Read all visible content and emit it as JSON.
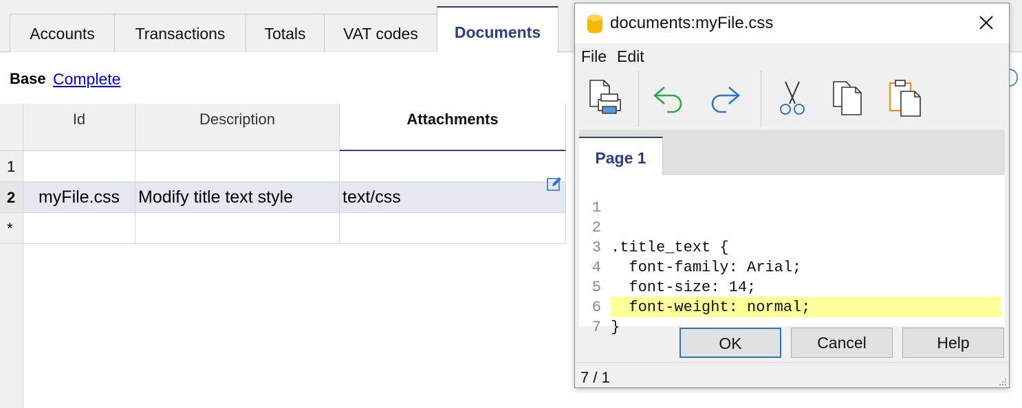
{
  "main": {
    "tabs": [
      {
        "label": "Accounts"
      },
      {
        "label": "Transactions"
      },
      {
        "label": "Totals"
      },
      {
        "label": "VAT codes"
      },
      {
        "label": "Documents"
      }
    ],
    "views": {
      "base": "Base",
      "complete": "Complete"
    },
    "table": {
      "columns": [
        "Id",
        "Description",
        "Attachments"
      ],
      "rows": [
        {
          "num": "1",
          "id": "",
          "description": "",
          "attachments": ""
        },
        {
          "num": "2",
          "id": "myFile.css",
          "description": "Modify title text style",
          "attachments": "text/css"
        },
        {
          "num": "*",
          "id": "",
          "description": "",
          "attachments": ""
        }
      ]
    }
  },
  "dialog": {
    "title": "documents:myFile.css",
    "menu": [
      "File",
      "Edit"
    ],
    "toolbar": [
      "print-icon",
      "undo-icon",
      "redo-icon",
      "cut-icon",
      "copy-icon",
      "paste-icon"
    ],
    "page_tab": "Page 1",
    "code_lines": [
      {
        "n": "1",
        "text": ""
      },
      {
        "n": "2",
        "text": ".title_text {"
      },
      {
        "n": "3",
        "text": "  font-family: Arial;"
      },
      {
        "n": "4",
        "text": "  font-size: 14;"
      },
      {
        "n": "5",
        "text": "  font-weight: normal;"
      },
      {
        "n": "6",
        "text": "}"
      },
      {
        "n": "7",
        "text": ""
      }
    ],
    "buttons": {
      "ok": "OK",
      "cancel": "Cancel",
      "help": "Help"
    },
    "status": "7 / 1"
  },
  "colors": {
    "accent": "#2a3f7f",
    "current_line": "#ffff99",
    "selected_row": "#e5e8f2",
    "link": "#0000ee"
  }
}
